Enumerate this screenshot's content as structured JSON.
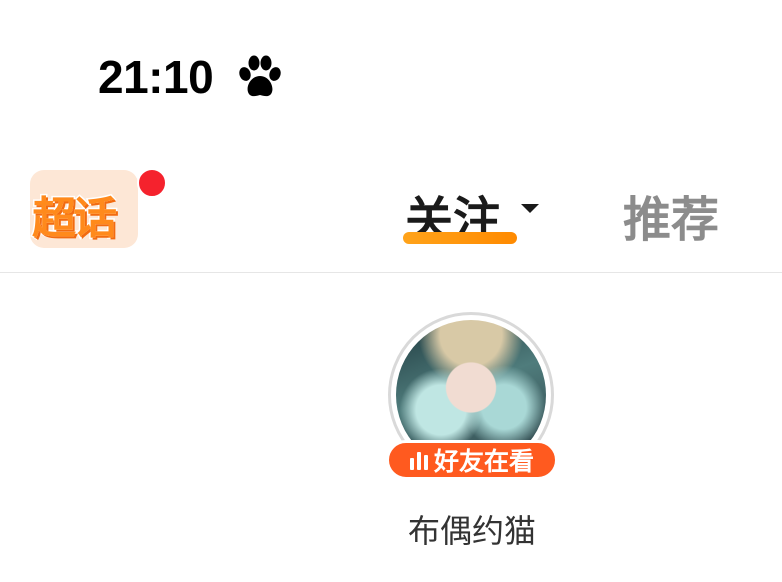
{
  "status_bar": {
    "time": "21:10",
    "indicator_icon": "paw-icon"
  },
  "top_nav": {
    "logo_label": "超话",
    "notification": "red-dot",
    "tabs": [
      {
        "label": "关注",
        "active": true,
        "has_dropdown": true
      },
      {
        "label": "推荐",
        "active": false
      }
    ],
    "accent_color": "#ff8a00"
  },
  "friend_card": {
    "badge_label": "好友在看",
    "badge_color": "#ff5a1f",
    "name": "布偶约猫"
  }
}
